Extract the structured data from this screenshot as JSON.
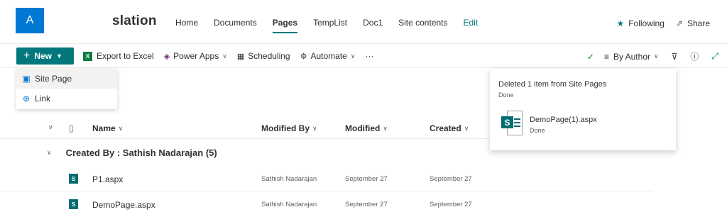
{
  "site": {
    "logo_letter": "A",
    "title": "slation"
  },
  "nav": {
    "items": [
      {
        "label": "Home"
      },
      {
        "label": "Documents"
      },
      {
        "label": "Pages",
        "active": true
      },
      {
        "label": "TempList"
      },
      {
        "label": "Doc1"
      },
      {
        "label": "Site contents"
      },
      {
        "label": "Edit"
      }
    ]
  },
  "header_actions": {
    "following": "Following",
    "share": "Share"
  },
  "command_bar": {
    "new_label": "New",
    "export_excel": "Export to Excel",
    "power_apps": "Power Apps",
    "scheduling": "Scheduling",
    "automate": "Automate",
    "more": "···",
    "sort_label": "By Author"
  },
  "new_menu": {
    "items": [
      {
        "label": "Site Page",
        "icon": "site-page-icon"
      },
      {
        "label": "Link",
        "icon": "globe-icon"
      }
    ]
  },
  "list": {
    "columns": {
      "name": "Name",
      "modified_by": "Modified By",
      "modified": "Modified",
      "created": "Created"
    },
    "group_label": "Created By : Sathish Nadarajan (5)",
    "rows": [
      {
        "name": "P1.aspx",
        "modified_by": "Sathish Nadarajan",
        "modified": "September 27",
        "created": "September 27"
      },
      {
        "name": "DemoPage.aspx",
        "modified_by": "Sathish Nadarajan",
        "modified": "September 27",
        "created": "September 27"
      }
    ]
  },
  "notification": {
    "title": "Deleted 1 item from Site Pages",
    "status": "Done",
    "file_name": "DemoPage(1).aspx",
    "file_status": "Done",
    "badge_letter": "S"
  },
  "colors": {
    "accent": "#03787c",
    "logo_bg": "#0078d4",
    "excel": "#107c41",
    "sharepoint": "#036c70"
  }
}
